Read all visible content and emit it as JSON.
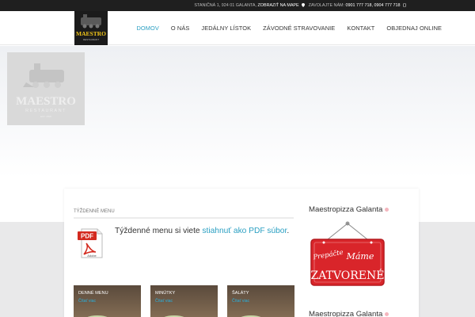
{
  "topbar": {
    "address": "STANIČNÁ 1, 924 01 GALANTA,",
    "map_link": "ZOBRAZIŤ NA MAPE",
    "call_label": "ZAVOLAJTE NÁM:",
    "phones": "0901 777 718, 0904 777 718"
  },
  "header": {
    "logo_text": "MAESTRO",
    "logo_sub": "RESTAURANT",
    "nav": [
      "DOMOV",
      "O NÁS",
      "JEDÁLNY LÍSTOK",
      "ZÁVODNÉ STRAVOVANIE",
      "KONTAKT",
      "OBJEDNAJ ONLINE"
    ],
    "active_nav": "DOMOV"
  },
  "hero": {
    "logo_text": "MAESTRO",
    "logo_sub": "RESTAURANT",
    "logo_est": "EST. 2009"
  },
  "main": {
    "section_title": "TÝŽDENNÉ MENU",
    "pdf_label": "PDF",
    "pdf_brand": "Adobe",
    "menu_text": "Týždenné menu si viete ",
    "menu_link": "stiahnuť ako PDF súbor",
    "menu_text_end": ".",
    "cards": [
      {
        "title": "DENNÉ MENU",
        "sub": "Čítať viac"
      },
      {
        "title": "MINÚTKY",
        "sub": "Čítať viac"
      },
      {
        "title": "ŠALÁTY",
        "sub": "Čítať viac"
      }
    ]
  },
  "sidebar": {
    "title1": "Maestropizza Galanta",
    "sign_line1": "Prepáčte",
    "sign_line2": "Máme",
    "sign_line3": "ZATVORENÉ",
    "title2": "Maestropizza Galanta"
  },
  "colors": {
    "accent": "#2a9fc2",
    "topbar_bg": "#1f1f1f",
    "sign_red": "#d9252a"
  }
}
